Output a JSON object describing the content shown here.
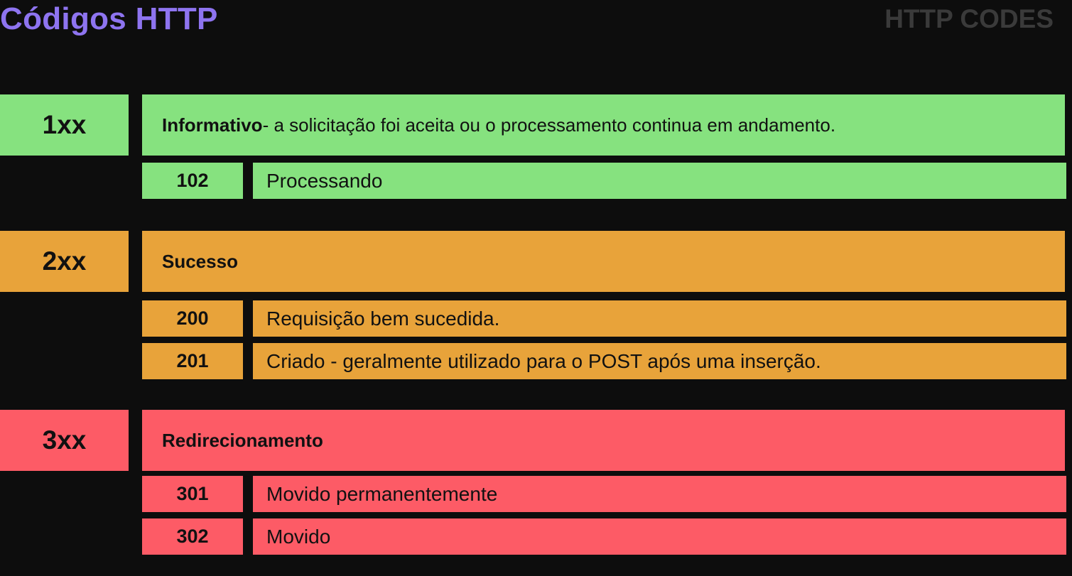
{
  "header": {
    "title": "Códigos HTTP",
    "subtitle": "HTTP CODES"
  },
  "groups": [
    {
      "code": "1xx",
      "name": "Informativo",
      "desc": " - a solicitação foi aceita ou o processamento continua em andamento.",
      "color": "#86e27f",
      "items": [
        {
          "code": "102",
          "desc": "Processando"
        }
      ]
    },
    {
      "code": "2xx",
      "name": "Sucesso",
      "desc": "",
      "color": "#e8a33a",
      "items": [
        {
          "code": "200",
          "desc": "Requisição bem sucedida."
        },
        {
          "code": "201",
          "desc": "Criado - geralmente utilizado para o POST após uma inserção."
        }
      ]
    },
    {
      "code": "3xx",
      "name": "Redirecionamento",
      "desc": "",
      "color": "#fd5b66",
      "items": [
        {
          "code": "301",
          "desc": "Movido permanentemente"
        },
        {
          "code": "302",
          "desc": "Movido"
        }
      ]
    }
  ]
}
